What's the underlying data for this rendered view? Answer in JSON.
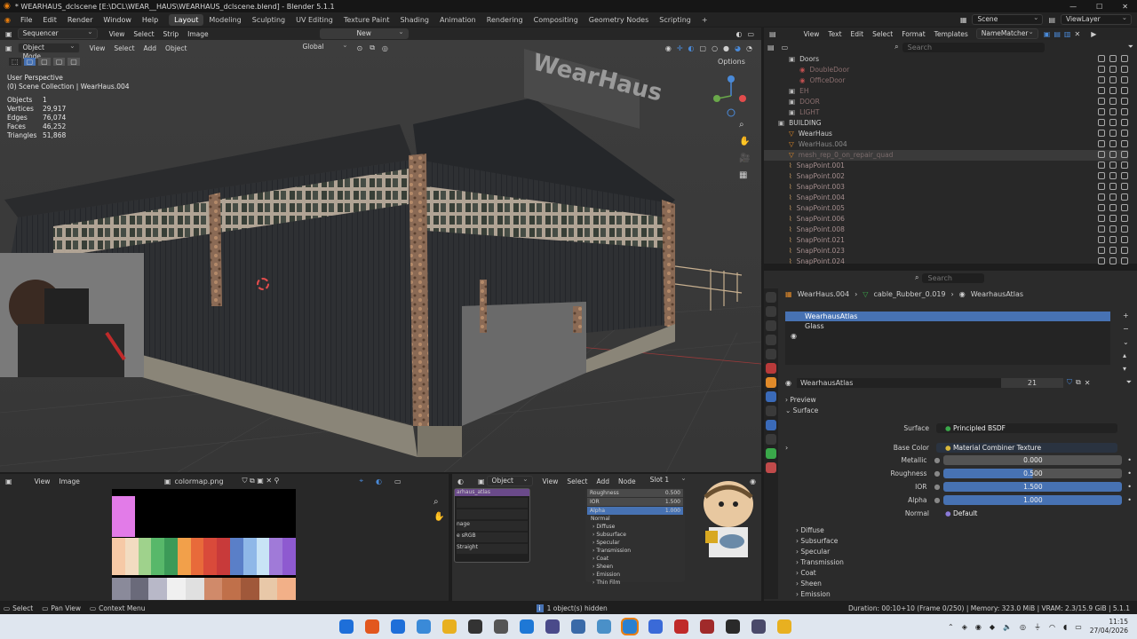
{
  "window": {
    "title": "* WEARHAUS_dclscene [E:\\DCL\\WEAR__HAUS\\WEARHAUS_dclscene.blend] - Blender 5.1.1",
    "min": "—",
    "max": "☐",
    "close": "✕"
  },
  "menu": [
    "File",
    "Edit",
    "Render",
    "Window",
    "Help"
  ],
  "workspaces": [
    "Layout",
    "Modeling",
    "Sculpting",
    "UV Editing",
    "Texture Paint",
    "Shading",
    "Animation",
    "Rendering",
    "Compositing",
    "Geometry Nodes",
    "Scripting",
    "+"
  ],
  "scene": {
    "label": "Scene",
    "viewlayer": "ViewLayer"
  },
  "viewport": {
    "editor": "Sequencer",
    "header_items": [
      "View",
      "Select",
      "Strip",
      "Image"
    ],
    "new_label": "New",
    "mode": "Object Mode",
    "menu": [
      "View",
      "Select",
      "Add",
      "Object"
    ],
    "orientation": "Global",
    "options": "Options",
    "overlay_title": "User Perspective",
    "overlay_sub": "(0) Scene Collection | WearHaus.004",
    "stats": [
      {
        "k": "Objects",
        "v": "1"
      },
      {
        "k": "Vertices",
        "v": "29,917"
      },
      {
        "k": "Edges",
        "v": "76,074"
      },
      {
        "k": "Faces",
        "v": "46,252"
      },
      {
        "k": "Triangles",
        "v": "51,868"
      }
    ],
    "sign_text": "WearHaus"
  },
  "text_editor_header": [
    "View",
    "Text",
    "Edit",
    "Select",
    "Format",
    "Templates"
  ],
  "namematcher": "NameMatcher",
  "outliner": {
    "search_placeholder": "Search",
    "rows": [
      {
        "name": "Doors",
        "indent": 2,
        "color": "#d0d0d0",
        "icon": "collection"
      },
      {
        "name": "DoubleDoor",
        "indent": 3,
        "color": "#8a6e6e",
        "icon": "mat"
      },
      {
        "name": "OfficeDoor",
        "indent": 3,
        "color": "#8a6e6e",
        "icon": "mat"
      },
      {
        "name": "EH",
        "indent": 2,
        "color": "#8a6e6e",
        "icon": "collection"
      },
      {
        "name": "DOOR",
        "indent": 2,
        "color": "#8a6e6e",
        "icon": "collection"
      },
      {
        "name": "LIGHT",
        "indent": 2,
        "color": "#8a6e6e",
        "icon": "collection"
      },
      {
        "name": "BUILDING",
        "indent": 1,
        "color": "#d0d0d0",
        "icon": "collection"
      },
      {
        "name": "WearHaus",
        "indent": 2,
        "color": "#d0d0d0",
        "icon": "mesh"
      },
      {
        "name": "WearHaus.004",
        "indent": 2,
        "color": "#8a8a8a",
        "icon": "mesh"
      },
      {
        "name": "mesh_rep_0_on_repair_quad",
        "indent": 2,
        "color": "#7a6b6b",
        "icon": "mesh"
      },
      {
        "name": "SnapPoint.001",
        "indent": 2,
        "color": "#a58e8e",
        "icon": "empty"
      },
      {
        "name": "SnapPoint.002",
        "indent": 2,
        "color": "#a58e8e",
        "icon": "empty"
      },
      {
        "name": "SnapPoint.003",
        "indent": 2,
        "color": "#a58e8e",
        "icon": "empty"
      },
      {
        "name": "SnapPoint.004",
        "indent": 2,
        "color": "#a58e8e",
        "icon": "empty"
      },
      {
        "name": "SnapPoint.005",
        "indent": 2,
        "color": "#a58e8e",
        "icon": "empty"
      },
      {
        "name": "SnapPoint.006",
        "indent": 2,
        "color": "#a58e8e",
        "icon": "empty"
      },
      {
        "name": "SnapPoint.008",
        "indent": 2,
        "color": "#a58e8e",
        "icon": "empty"
      },
      {
        "name": "SnapPoint.021",
        "indent": 2,
        "color": "#a58e8e",
        "icon": "empty"
      },
      {
        "name": "SnapPoint.023",
        "indent": 2,
        "color": "#a58e8e",
        "icon": "empty"
      },
      {
        "name": "SnapPoint.024",
        "indent": 2,
        "color": "#a58e8e",
        "icon": "empty"
      }
    ]
  },
  "properties": {
    "search_placeholder": "Search",
    "breadcrumb": [
      "WearHaus.004",
      "cable_Rubber_0.019",
      "WearhausAtlas"
    ],
    "slots": [
      "WearhausAtlas",
      "Glass"
    ],
    "material_name": "WearhausAtlas",
    "users": "21",
    "preview": "Preview",
    "surface_panel": "Surface",
    "surface": {
      "label": "Surface",
      "value": "Principled BSDF"
    },
    "base_color": {
      "label": "Base Color",
      "value": "Material Combiner Texture"
    },
    "fields": [
      {
        "label": "Metallic",
        "value": "0.000",
        "fill": 0
      },
      {
        "label": "Roughness",
        "value": "0.500",
        "fill": 0.5
      },
      {
        "label": "IOR",
        "value": "1.500",
        "fill": 1
      },
      {
        "label": "Alpha",
        "value": "1.000",
        "fill": 1
      }
    ],
    "normal": {
      "label": "Normal",
      "value": "Default"
    },
    "subpanels": [
      "Diffuse",
      "Subsurface",
      "Specular",
      "Transmission",
      "Coat",
      "Sheen",
      "Emission"
    ]
  },
  "image_editor": {
    "menu": [
      "View",
      "Image"
    ],
    "image": "colormap.png",
    "palette": [
      "#f6c9a6",
      "#f2dcc1",
      "#9fd28c",
      "#58b86a",
      "#3c9a58",
      "#f2a04a",
      "#e86a3a",
      "#d94a3a",
      "#c83a3a",
      "#5a7fc8",
      "#8fb8e8",
      "#c8e4f6",
      "#a07ad8",
      "#8e5ad0"
    ],
    "palette2": [
      "#8a8a9a",
      "#6a6a7a",
      "#b8b8c8",
      "#f0f0f0",
      "#e0e0e0",
      "#d08a6a",
      "#c0704a",
      "#a0583a",
      "#e8c8a8",
      "#f2b088"
    ]
  },
  "shader": {
    "mode": "Object",
    "menu": [
      "View",
      "Select",
      "Add",
      "Node"
    ],
    "slot": "Slot 1",
    "left_vals": [
      "",
      "",
      "nage",
      "e  sRGB",
      "Straight"
    ],
    "left_title": "arhaus_atlas",
    "rows": [
      {
        "label": "Roughness",
        "value": "0.500"
      },
      {
        "label": "IOR",
        "value": "1.500"
      },
      {
        "label": "Alpha",
        "value": "1.000"
      }
    ],
    "normal": "Normal",
    "items": [
      "Diffuse",
      "Subsurface",
      "Specular",
      "Transmission",
      "Coat",
      "Sheen",
      "Emission",
      "Thin Film"
    ]
  },
  "status": {
    "left": [
      "Select",
      "Pan View",
      "Context Menu"
    ],
    "center": "1 object(s) hidden",
    "right": "Duration: 00:10+10 (Frame 0/250) | Memory: 323.0 MiB | VRAM: 2.3/15.9 GiB | 5.1.1"
  },
  "clock": {
    "time": "11:15",
    "date": "27/04/2026"
  },
  "taskbar_icons": [
    "start-icon",
    "brave-icon",
    "search-icon",
    "python-icon",
    "folder-icon",
    "terminal-icon",
    "app-icon",
    "vscode-icon",
    "app2-icon",
    "app3-icon",
    "app4-icon",
    "blender-icon",
    "app5-icon",
    "app6-icon",
    "app7-icon",
    "app8-icon",
    "app9-icon",
    "chrome-icon"
  ]
}
